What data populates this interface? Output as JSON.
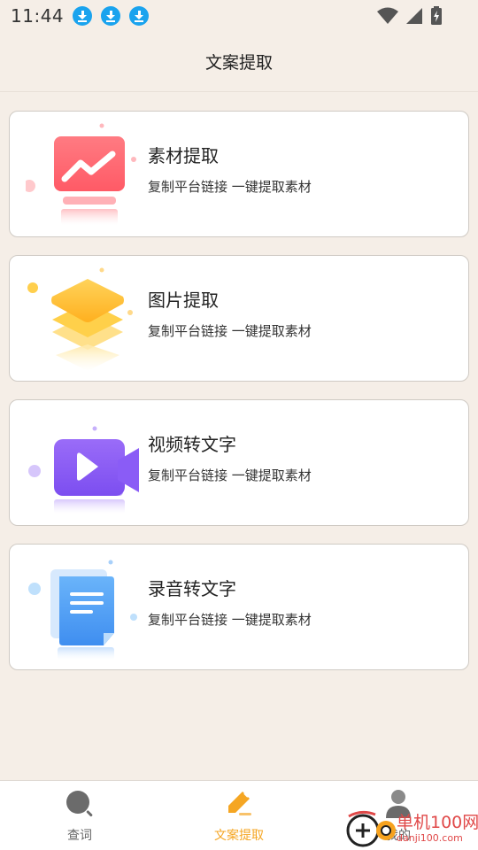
{
  "status_bar": {
    "time": "11:44",
    "icons": [
      "download-icon",
      "download-icon",
      "download-icon",
      "wifi-icon",
      "signal-icon",
      "battery-icon"
    ]
  },
  "header": {
    "title": "文案提取"
  },
  "cards": [
    {
      "title": "素材提取",
      "subtitle": "复制平台链接 一键提取素材",
      "icon": "chart-screen-icon",
      "color": "#ff6b73"
    },
    {
      "title": "图片提取",
      "subtitle": "复制平台链接 一键提取素材",
      "icon": "layers-icon",
      "color": "#ffbf2f"
    },
    {
      "title": "视频转文字",
      "subtitle": "复制平台链接 一键提取素材",
      "icon": "video-camera-icon",
      "color": "#8a5cf6"
    },
    {
      "title": "录音转文字",
      "subtitle": "复制平台链接 一键提取素材",
      "icon": "document-icon",
      "color": "#4e9bf5"
    }
  ],
  "bottom_nav": {
    "items": [
      {
        "label": "查词",
        "icon": "search-icon",
        "active": false
      },
      {
        "label": "文案提取",
        "icon": "pen-icon",
        "active": true
      },
      {
        "label": "我的",
        "icon": "user-icon",
        "active": false
      }
    ],
    "active_color": "#f5a623"
  },
  "watermark": {
    "text_cn": "单机100网",
    "text_en": "danji100.com"
  }
}
